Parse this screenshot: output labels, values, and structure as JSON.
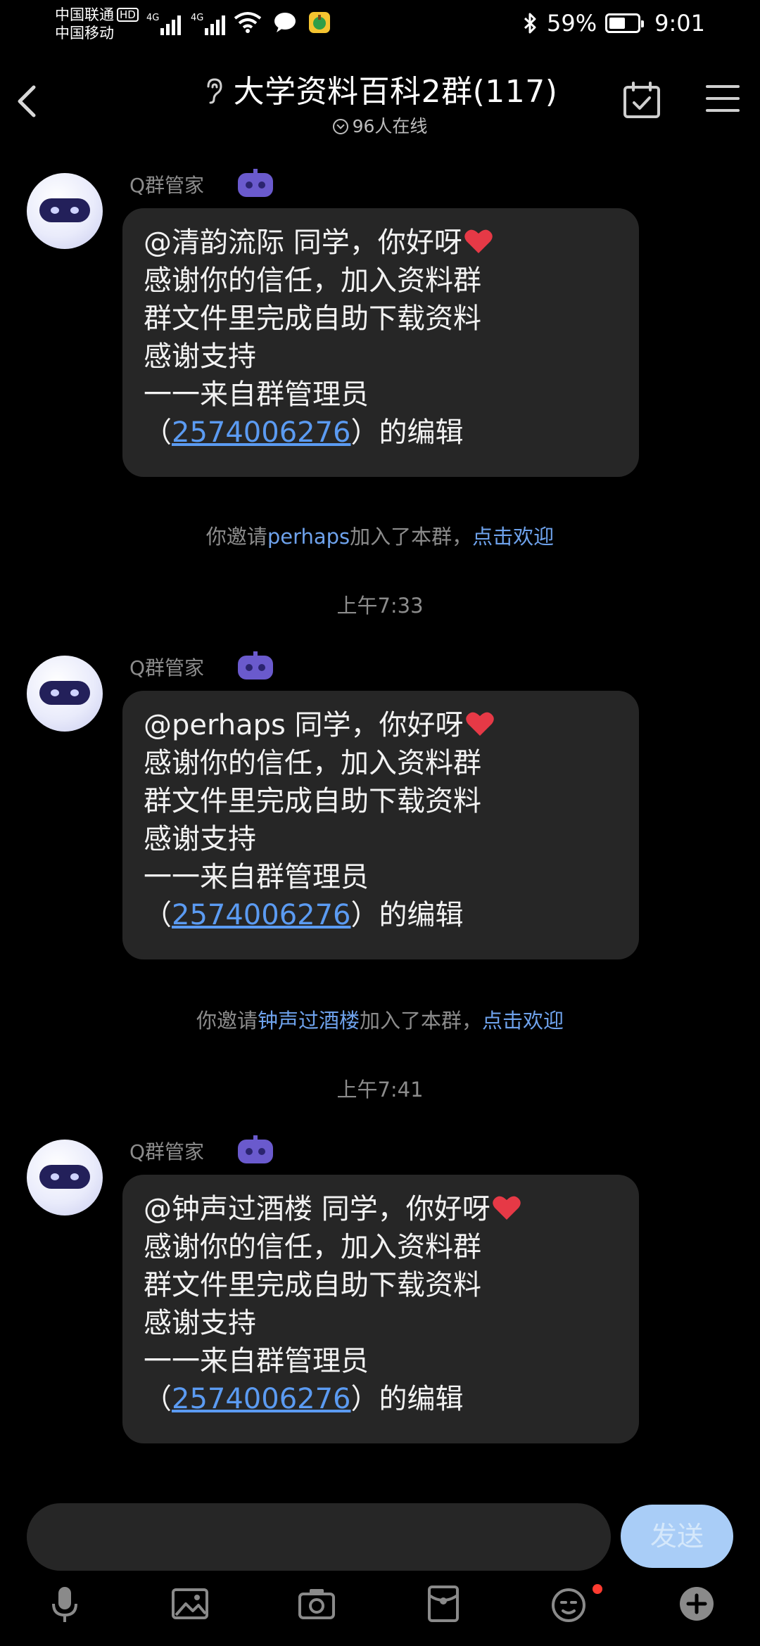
{
  "status_bar": {
    "carrier1": "中国联通",
    "carrier1_badge": "HD",
    "carrier2": "中国移动",
    "sig_tag": "4G",
    "battery": "59%",
    "battery_level": 0.59,
    "time": "9:01"
  },
  "header": {
    "title": "大学资料百科2群(117)",
    "online": "96人在线"
  },
  "messages": [
    {
      "sender": "Q群管家",
      "mention": "@清韵流际 同学，你好呀",
      "line2": "感谢你的信任，加入资料群",
      "line3": "群文件里完成自助下载资料",
      "line4": "感谢支持",
      "line5": "一一来自群管理员",
      "lp": "（",
      "qq": "2574006276",
      "rp": "）的编辑"
    },
    {
      "sender": "Q群管家",
      "mention": "@perhaps 同学，你好呀",
      "line2": "感谢你的信任，加入资料群",
      "line3": "群文件里完成自助下载资料",
      "line4": "感谢支持",
      "line5": "一一来自群管理员",
      "lp": "（",
      "qq": "2574006276",
      "rp": "）的编辑"
    },
    {
      "sender": "Q群管家",
      "mention": "@钟声过酒楼 同学，你好呀",
      "line2": "感谢你的信任，加入资料群",
      "line3": "群文件里完成自助下载资料",
      "line4": "感谢支持",
      "line5": "一一来自群管理员",
      "lp": "（",
      "qq": "2574006276",
      "rp": "）的编辑"
    }
  ],
  "system": [
    {
      "prefix": "你邀请",
      "name": "perhaps",
      "suffix": "加入了本群，",
      "action": "点击欢迎"
    },
    {
      "prefix": "你邀请",
      "name": "钟声过酒楼",
      "suffix": "加入了本群，",
      "action": "点击欢迎"
    }
  ],
  "times": [
    "上午7:33",
    "上午7:41"
  ],
  "input": {
    "send_label": "发送"
  },
  "toolbar_icons": [
    "mic-icon",
    "image-icon",
    "camera-icon",
    "red-packet-icon",
    "emoji-icon",
    "plus-icon"
  ],
  "colors": {
    "link": "#5b9bf2",
    "send": "#a9cdf7",
    "bubble": "#262626",
    "bot": "#6a5acd"
  }
}
